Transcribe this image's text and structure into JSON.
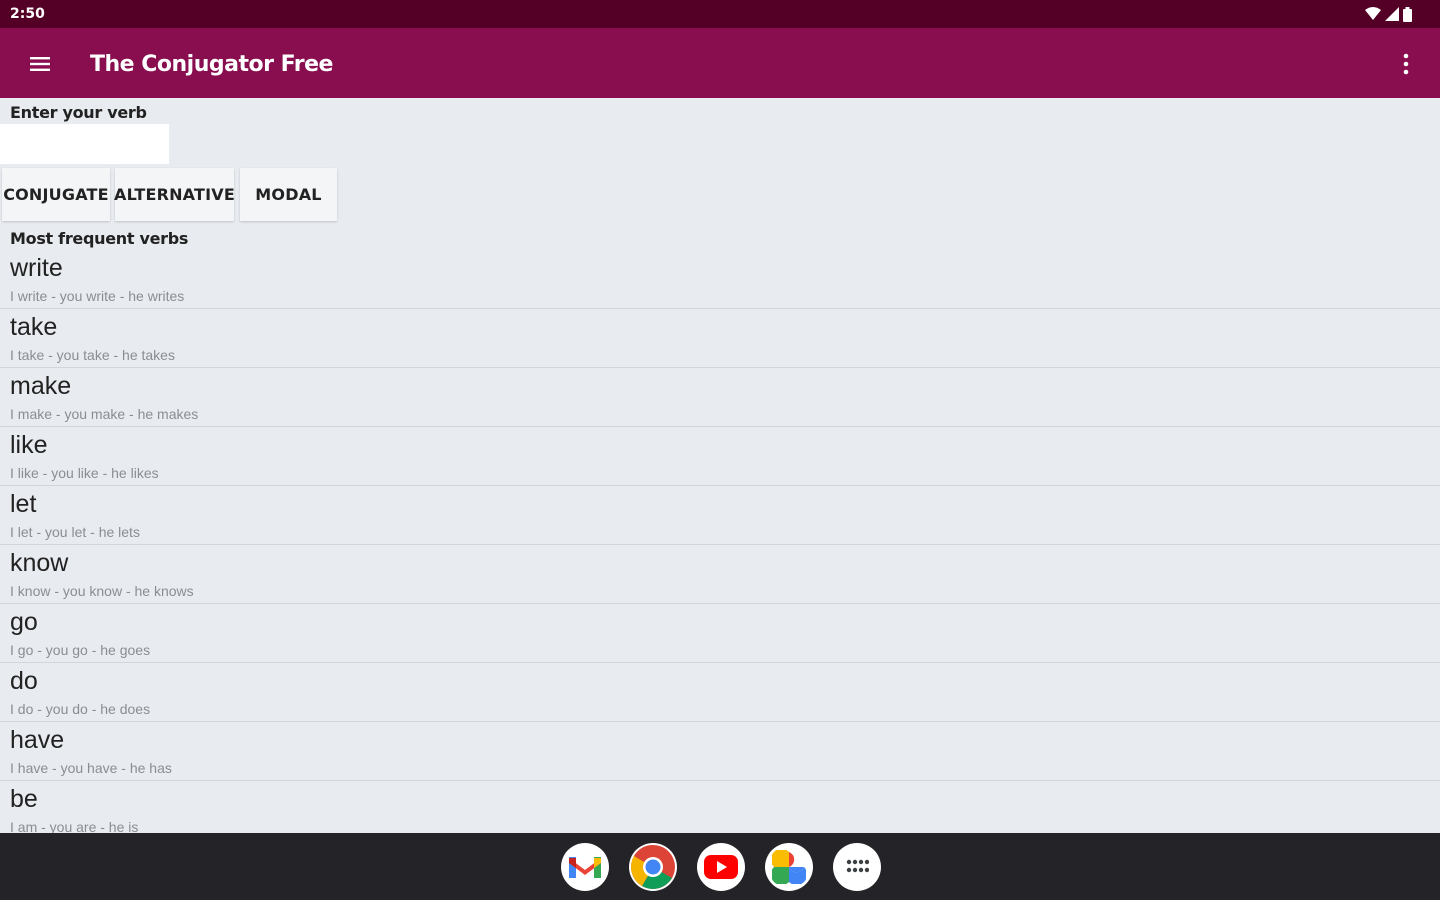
{
  "status_bar": {
    "time": "2:50",
    "icons": [
      "wifi-icon",
      "signal-icon",
      "battery-icon"
    ]
  },
  "app_bar": {
    "title": "The Conjugator Free",
    "icons": [
      "menu-icon",
      "overflow-menu-icon"
    ]
  },
  "form": {
    "input_label": "Enter your verb",
    "input_value": "",
    "buttons": {
      "conjugate": "CONJUGATE",
      "alternative": "ALTERNATIVE",
      "modal": "MODAL"
    }
  },
  "verbs": {
    "header": "Most frequent verbs",
    "items": [
      {
        "verb": "write",
        "forms": "I write - you write - he writes"
      },
      {
        "verb": "take",
        "forms": "I take - you take - he takes"
      },
      {
        "verb": "make",
        "forms": "I make - you make - he makes"
      },
      {
        "verb": "like",
        "forms": "I like - you like - he likes"
      },
      {
        "verb": "let",
        "forms": "I let - you let - he lets"
      },
      {
        "verb": "know",
        "forms": "I know - you know - he knows"
      },
      {
        "verb": "go",
        "forms": "I go - you go - he goes"
      },
      {
        "verb": "do",
        "forms": "I do - you do - he does"
      },
      {
        "verb": "have",
        "forms": "I have - you have - he has"
      },
      {
        "verb": "be",
        "forms": "I am - you are - he is"
      }
    ]
  },
  "dock": {
    "apps": [
      "gmail-icon",
      "chrome-icon",
      "youtube-icon",
      "photos-icon",
      "app-drawer-icon"
    ]
  },
  "colors": {
    "status_bar": "#540026",
    "app_bar": "#880e4f",
    "background": "#e8ebef",
    "nav_bar": "#242428"
  }
}
